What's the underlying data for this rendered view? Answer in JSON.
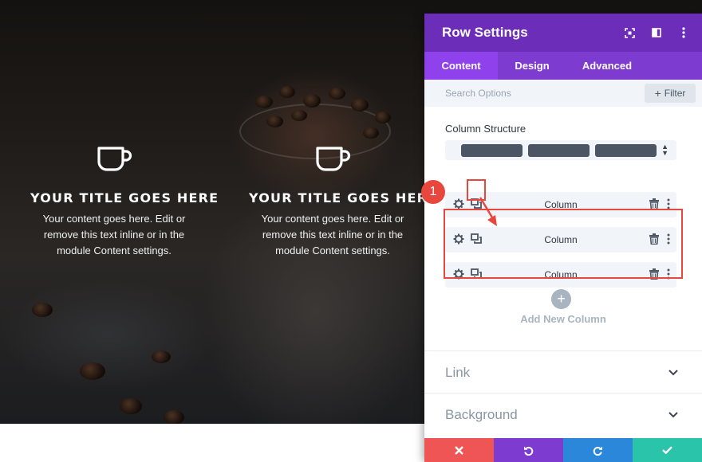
{
  "page": {
    "blurbs": [
      {
        "title": "YOUR TITLE GOES HERE",
        "body": "Your content goes here. Edit or remove this text inline or in the module Content settings."
      },
      {
        "title": "YOUR TITLE GOES HERE",
        "body": "Your content goes here. Edit or remove this text inline or in the module Content settings."
      }
    ]
  },
  "panel": {
    "title": "Row Settings",
    "tabs": [
      {
        "label": "Content",
        "active": true
      },
      {
        "label": "Design",
        "active": false
      },
      {
        "label": "Advanced",
        "active": false
      }
    ],
    "search": {
      "placeholder": "Search Options",
      "value": ""
    },
    "filter_label": "Filter",
    "column_structure_label": "Column Structure",
    "columns": [
      {
        "label": "Column"
      },
      {
        "label": "Column"
      },
      {
        "label": "Column"
      }
    ],
    "add_column_label": "Add New Column",
    "accordions": [
      {
        "label": "Link"
      },
      {
        "label": "Background"
      }
    ],
    "footer": {
      "colors": {
        "cancel": "#ef5555",
        "undo": "#7e3bd0",
        "redo": "#2b87da",
        "save": "#29c4a9"
      }
    }
  },
  "annotation": {
    "step_number": "1",
    "color": "#e8473e"
  },
  "colors": {
    "header": "#6c2eb9",
    "tabs": "#7e3bd0",
    "active_tab": "#8f42ec"
  }
}
